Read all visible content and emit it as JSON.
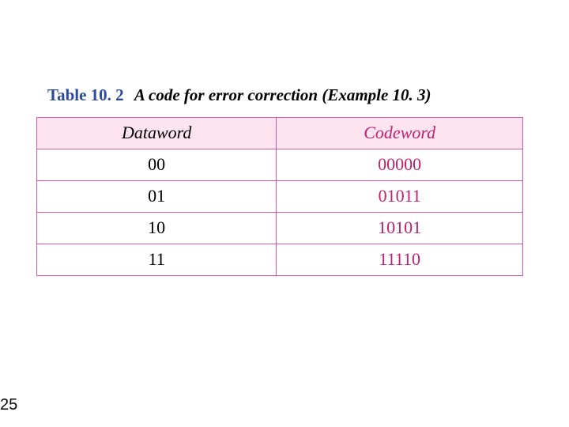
{
  "caption": {
    "label": "Table 10. 2",
    "title": "A code for error correction (Example 10. 3)"
  },
  "table": {
    "headers": {
      "dataword": "Dataword",
      "codeword": "Codeword"
    },
    "rows": [
      {
        "dataword": "00",
        "codeword": "00000"
      },
      {
        "dataword": "01",
        "codeword": "01011"
      },
      {
        "dataword": "10",
        "codeword": "10101"
      },
      {
        "dataword": "11",
        "codeword": "11110"
      }
    ]
  },
  "page_number": "25",
  "chart_data": {
    "type": "table",
    "title": "Table 10.2 A code for error correction (Example 10.3)",
    "columns": [
      "Dataword",
      "Codeword"
    ],
    "rows": [
      [
        "00",
        "00000"
      ],
      [
        "01",
        "01011"
      ],
      [
        "10",
        "10101"
      ],
      [
        "11",
        "11110"
      ]
    ]
  }
}
